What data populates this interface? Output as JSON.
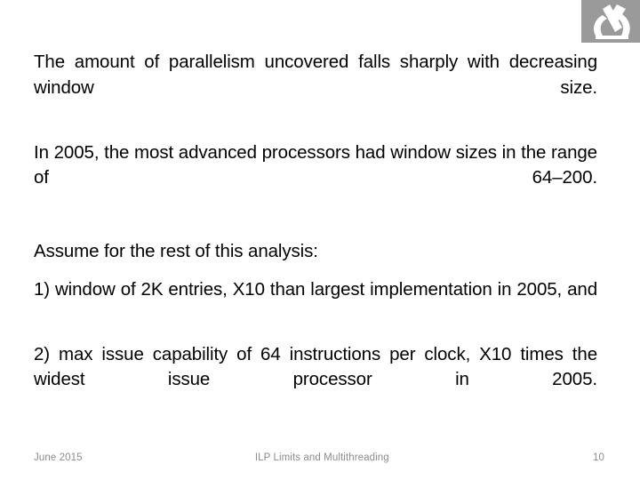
{
  "slide": {
    "logo_icon": "microscope-icon",
    "logo_background_color": "#9a9a9a",
    "logo_glyph_color": "#ffffff",
    "text_color": "#000000",
    "background_color": "#ffffff",
    "paragraphs": [
      "The amount of parallelism uncovered falls sharply with decreasing window size.",
      "In 2005, the most advanced processors had window sizes in the range of 64–200.",
      "Assume for the rest of this analysis:",
      "1) window of 2K entries, X10 than largest implementation in 2005, and",
      "2) max issue capability of 64 instructions per clock, X10 times the widest issue processor in 2005."
    ]
  },
  "footer": {
    "date": "June 2015",
    "title": "ILP Limits and Multithreading",
    "page_number": "10",
    "text_color": "#8c8c8c"
  }
}
